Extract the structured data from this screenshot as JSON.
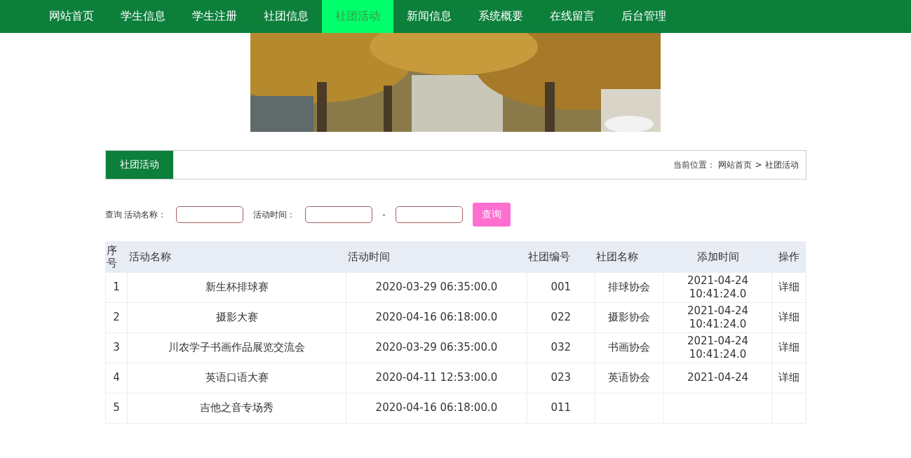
{
  "nav": [
    {
      "label": "网站首页",
      "selected": false
    },
    {
      "label": "学生信息",
      "selected": false
    },
    {
      "label": "学生注册",
      "selected": false
    },
    {
      "label": "社团信息",
      "selected": false
    },
    {
      "label": "社团活动",
      "selected": true
    },
    {
      "label": "新闻信息",
      "selected": false
    },
    {
      "label": "系统概要",
      "selected": false
    },
    {
      "label": "在线留言",
      "selected": false
    },
    {
      "label": "后台管理",
      "selected": false
    }
  ],
  "section": {
    "title": "社团活动",
    "breadcrumb_label": "当前位置：",
    "breadcrumb": [
      "网站首页",
      "社团活动"
    ],
    "separator": ">"
  },
  "search": {
    "label": "查询 活动名称：",
    "time_label": "活动时间：",
    "dash": "-",
    "button": "查询"
  },
  "table": {
    "columns": [
      "序号",
      "活动名称",
      "活动时间",
      "社团编号",
      "社团名称",
      "添加时间",
      "操作"
    ],
    "rows": [
      {
        "no": "1",
        "name": "新生杯排球赛",
        "time": "2020-03-29 06:35:00.0",
        "club_no": "001",
        "club": "排球协会",
        "added": [
          "2021-04-24",
          "10:41:24.0"
        ],
        "action": "详细"
      },
      {
        "no": "2",
        "name": "摄影大赛",
        "time": "2020-04-16 06:18:00.0",
        "club_no": "022",
        "club": "摄影协会",
        "added": [
          "2021-04-24",
          "10:41:24.0"
        ],
        "action": "详细"
      },
      {
        "no": "3",
        "name": "川农学子书画作品展览交流会",
        "time": "2020-03-29 06:35:00.0",
        "club_no": "032",
        "club": "书画协会",
        "added": [
          "2021-04-24",
          "10:41:24.0"
        ],
        "action": "详细"
      },
      {
        "no": "4",
        "name": "英语口语大赛",
        "time": "2020-04-11 12:53:00.0",
        "club_no": "023",
        "club": "英语协会",
        "added": [
          "2021-04-24"
        ],
        "action": "详细"
      },
      {
        "no": "5",
        "name": "吉他之音专场秀",
        "time": "2020-04-16 06:18:00.0",
        "club_no": "011"
      }
    ]
  }
}
